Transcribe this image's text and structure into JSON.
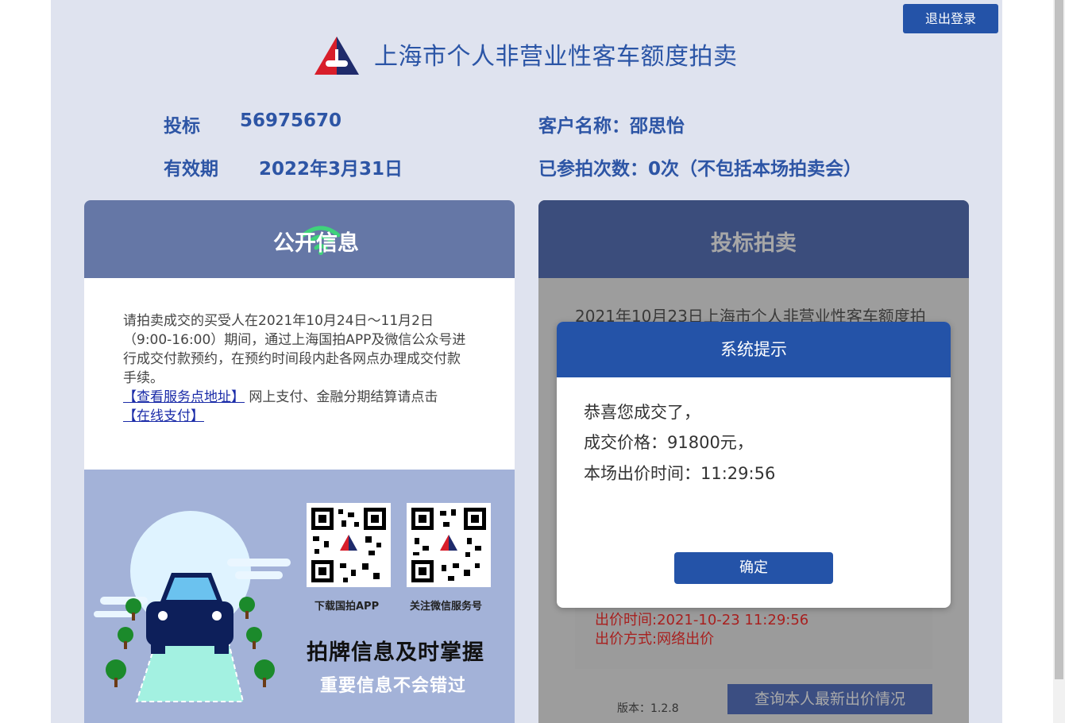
{
  "header": {
    "title": "上海市个人非营业性客车额度拍卖",
    "logout_label": "退出登录"
  },
  "bidder": {
    "bid_label": "投标",
    "bid_number": "56975670",
    "validity_label": "有效期",
    "validity_date": "2022年3月31日",
    "customer_name_label": "客户名称：",
    "customer_name": "邵思怡",
    "participation_label": "已参拍次数：",
    "participation_count": "0次（不包括本场拍卖会）"
  },
  "public_info": {
    "title": "公开信息",
    "notice_text": "请拍卖成交的买受人在2021年10月24日～11月2日（9:00-16:00）期间，通过上海国拍APP及微信公众号进行成交付款预约，在预约时间段内赴各网点办理成交付款手续。",
    "service_link": "【查看服务点地址】",
    "payment_text": " 网上支付、金融分期结算请点击",
    "payment_link": "【在线支付】",
    "qr_app_label": "下载国拍APP",
    "qr_wechat_label": "关注微信服务号",
    "promo_main": "拍牌信息及时掌握",
    "promo_sub": "重要信息不会错过"
  },
  "auction": {
    "title": "投标拍卖",
    "notice_text": "2021年10月23日上海市个人非营业性客车额度拍",
    "bid_time": "出价时间:2021-10-23 11:29:56",
    "bid_method": "出价方式:网络出价",
    "query_button": "查询本人最新出价情况",
    "version": "版本：1.2.8"
  },
  "modal": {
    "title": "系统提示",
    "line1": "恭喜您成交了，",
    "line2": "成交价格：91800元，",
    "line3": "本场出价时间：11:29:56",
    "ok_label": "确定"
  },
  "colors": {
    "brand_blue": "#2453a8",
    "text_blue": "#2d55a5",
    "panel_header": "#6577a6",
    "alert_red": "#a8201f"
  }
}
